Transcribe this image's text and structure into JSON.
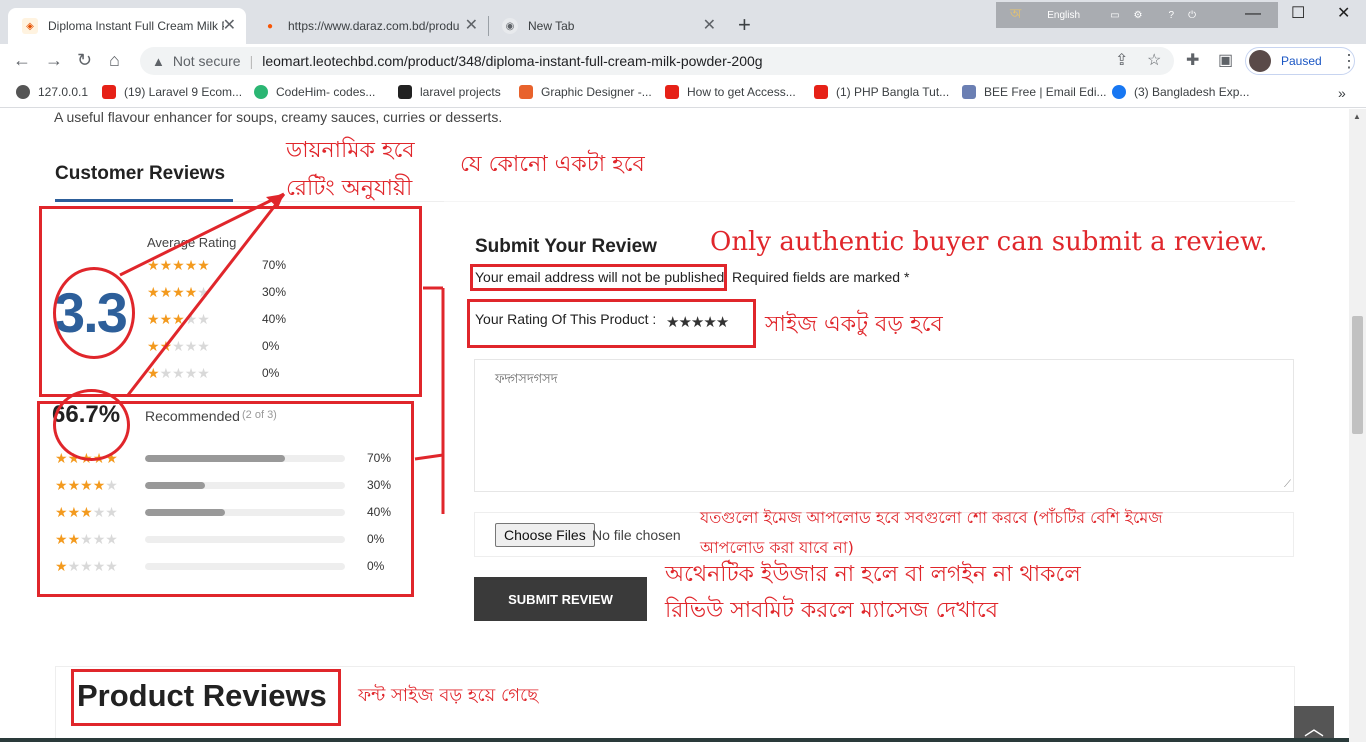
{
  "browser": {
    "tabs": [
      {
        "title": "Diploma Instant Full Cream Milk P",
        "active": true
      },
      {
        "title": "https://www.daraz.com.bd/produ",
        "active": false
      },
      {
        "title": "New Tab",
        "active": false
      }
    ],
    "lang_bar": "English",
    "omnibox": {
      "security": "Not secure",
      "url": "leomart.leotechbd.com/product/348/diploma-instant-full-cream-milk-powder-200g"
    },
    "profile": "Paused",
    "bookmarks": [
      "127.0.0.1",
      "(19) Laravel 9 Ecom...",
      "CodeHim- codes...",
      "laravel projects",
      "Graphic Designer -...",
      "How to get Access...",
      "(1) PHP Bangla Tut...",
      "BEE Free | Email Edi...",
      "(3) Bangladesh Exp..."
    ]
  },
  "page": {
    "top_text": "A useful flavour enhancer for soups, creamy sauces, curries or desserts.",
    "customer_reviews_tab": "Customer Reviews",
    "average": {
      "label": "Average Rating",
      "value": "3.3",
      "rows": [
        {
          "stars": 5,
          "pct": "70%"
        },
        {
          "stars": 4,
          "pct": "30%"
        },
        {
          "stars": 3,
          "pct": "40%"
        },
        {
          "stars": 2,
          "pct": "0%"
        },
        {
          "stars": 1,
          "pct": "0%"
        }
      ]
    },
    "recommended": {
      "value": "66.7%",
      "label": "Recommended",
      "count": "(2 of 3)",
      "rows": [
        {
          "stars": 5,
          "pct": "70%",
          "fill": 0.7
        },
        {
          "stars": 4,
          "pct": "30%",
          "fill": 0.3
        },
        {
          "stars": 3,
          "pct": "40%",
          "fill": 0.4
        },
        {
          "stars": 2,
          "pct": "0%",
          "fill": 0
        },
        {
          "stars": 1,
          "pct": "0%",
          "fill": 0
        }
      ]
    },
    "submit": {
      "title": "Submit Your Review",
      "email_note": "Your email address will not be published",
      "required_note": "Required fields are marked *",
      "rating_label": "Your Rating Of This Product :",
      "rating_stars": 5,
      "review_text": "ফদ্গসদগসদ",
      "choose_files": "Choose Files",
      "no_file": "No file chosen",
      "button": "SUBMIT REVIEW"
    },
    "product_reviews_title": "Product Reviews"
  },
  "annotations": {
    "dynamic": "ডায়নামিক হবে",
    "by_rating": "রেটিং অনুযায়ী",
    "any_one": "যে কোনো একটা হবে",
    "authentic": "Only authentic buyer can submit a review.",
    "size_bigger": "সাইজ একটু বড় হবে",
    "images_line1": "যতগুলো ইমেজ আপলোড হবে সবগুলো শো করবে (পাঁচটির বেশি ইমেজ",
    "images_line2": "আপলোড করা যাবে না)",
    "auth_line1": "অথেনটিক ইউজার না হলে বা লগইন না থাকলে",
    "auth_line2": "রিভিউ সাবমিট করলে ম্যাসেজ দেখাবে",
    "font_big": "ফন্ট সাইজ বড় হয়ে গেছে"
  },
  "colors": {
    "annotation_red": "#e0262b",
    "star_on": "#f39a1e",
    "star_off": "#d9d9d9",
    "button_dark": "#3a3a3a",
    "rating_blue": "#2d5f9a"
  }
}
